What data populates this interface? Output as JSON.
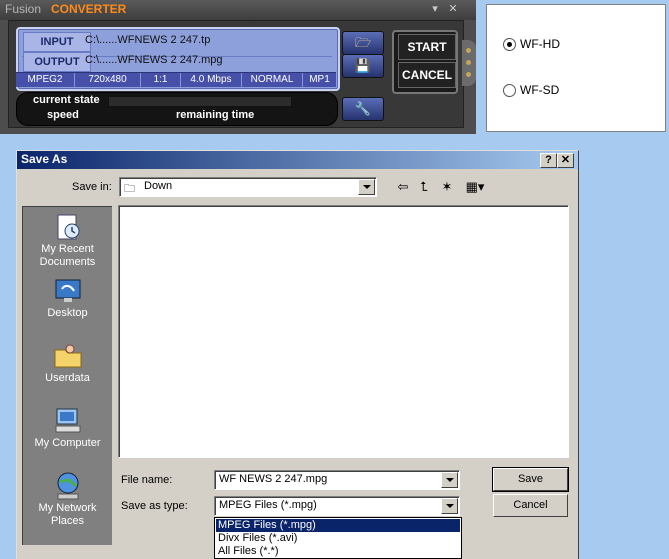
{
  "converter": {
    "title_part1": "Fusion",
    "title_part2": "CONVERTER",
    "input_label": "INPUT",
    "output_label": "OUTPUT",
    "input_path": "C:\\......WFNEWS 2   247.tp",
    "output_path": "C:\\......WFNEWS 2   247.mpg",
    "params": [
      "MPEG2",
      "720x480",
      "1:1",
      "4.0 Mbps",
      "NORMAL",
      "MP1"
    ],
    "current_state_label": "current state",
    "speed_label": "speed",
    "remaining_label": "remaining time",
    "start_label": "START",
    "cancel_label": "CANCEL",
    "progress": 0
  },
  "profile": {
    "options": [
      "WF-HD",
      "WF-SD"
    ],
    "selected": "WF-HD"
  },
  "save_dialog": {
    "title": "Save As",
    "help_label": "?",
    "close_label": "✕",
    "save_in_label": "Save in:",
    "save_in_value": "Down",
    "places": [
      "My Recent Documents",
      "Desktop",
      "Userdata",
      "My Computer",
      "My Network Places"
    ],
    "file_name_label": "File name:",
    "file_name_value": "WF NEWS 2   247.mpg",
    "save_as_type_label": "Save as type:",
    "save_as_type_value": "MPEG Files (*.mpg)",
    "type_options": [
      "MPEG Files (*.mpg)",
      "Divx Files (*.avi)",
      "All Files (*.*)"
    ],
    "save_button": "Save",
    "cancel_button": "Cancel",
    "toolbar_icons": [
      "back-icon",
      "up-folder-icon",
      "new-folder-icon",
      "view-menu-icon"
    ]
  }
}
